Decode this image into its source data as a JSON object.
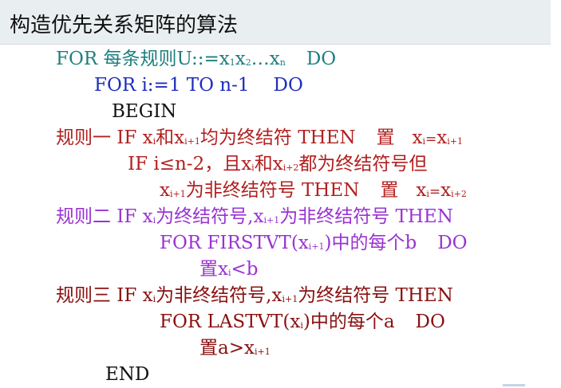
{
  "title": "构造优先关系矩阵的算法",
  "lines": {
    "l1": {
      "a": "FOR  每条规则U::=x",
      "s1": "1",
      "b": "x",
      "s2": "2",
      "c": "…x",
      "s3": "n",
      "d": "DO"
    },
    "l2": {
      "a": "FOR  i:=1  TO  n-1",
      "b": "DO"
    },
    "l3": {
      "a": "BEGIN"
    },
    "l4": {
      "a": "规则一 IF  x",
      "s1": "i",
      "b": "和x",
      "s2": "i+1",
      "c": "均为终结符 THEN",
      "d": "置",
      "e": "x",
      "s3": "i",
      "f": "=",
      "g": "x",
      "s4": "i+1"
    },
    "l5": {
      "a": "IF  i≤n-2，且x",
      "s1": "i",
      "b": "和x",
      "s2": "i+2",
      "c": "都为终结符号但"
    },
    "l6": {
      "a": "x",
      "s1": "i+1",
      "b": "为非终结符号  THEN",
      "c": "置",
      "d": "x",
      "s2": "i",
      "e": "=",
      "f": "x",
      "s3": "i+2"
    },
    "l7": {
      "a": "规则二 IF  x",
      "s1": "i",
      "b": "为终结符号,x",
      "s2": "i+1",
      "c": "为非终结符号  THEN"
    },
    "l8": {
      "a": "FOR FIRSTVT(x",
      "s1": "i+1",
      "b": ")中的每个b",
      "c": "DO"
    },
    "l9": {
      "a": "置x",
      "s1": "i",
      "b": "<b"
    },
    "l10": {
      "a": "规则三 IF  x",
      "s1": "i",
      "b": "为非终结符号,x",
      "s2": "i+1",
      "c": "为终结符号  THEN"
    },
    "l11": {
      "a": "FOR LASTVT(x",
      "s1": "i",
      "b": ")中的每个a",
      "c": "DO"
    },
    "l12": {
      "a": "置a>x",
      "s1": "i+1"
    },
    "l13": {
      "a": "END"
    }
  }
}
